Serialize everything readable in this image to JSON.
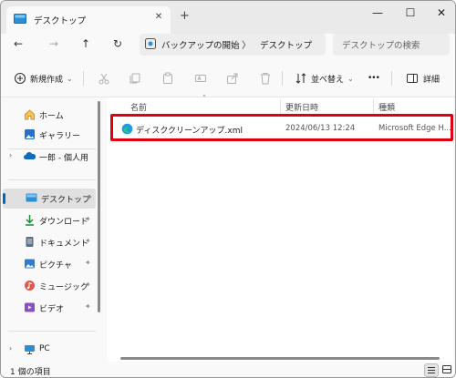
{
  "tab": {
    "title": "デスクトップ",
    "close_glyph": "✕",
    "new_tab_glyph": "+"
  },
  "window_controls": {
    "minimize": "—",
    "maximize": "☐",
    "close": "✕"
  },
  "nav": {
    "back": "←",
    "forward": "→",
    "up": "↑",
    "refresh": "↻"
  },
  "address": {
    "segment1": "バックアップの開始",
    "separator": "〉",
    "segment2": "デスクトップ"
  },
  "search": {
    "placeholder": "デスクトップの検索"
  },
  "toolbar": {
    "new_label": "新規作成",
    "new_chevron": "⌄",
    "sort_label": "並べ替え",
    "sort_chevron": "⌄",
    "more_label": "•••",
    "details_label": "詳細"
  },
  "sidebar": {
    "items": [
      {
        "label": "ホーム",
        "icon": "home-icon"
      },
      {
        "label": "ギャラリー",
        "icon": "gallery-icon"
      },
      {
        "label": "一郎 - 個人用",
        "icon": "onedrive-icon",
        "chevron": "›"
      },
      {
        "label": "デスクトップ",
        "icon": "desktop-icon",
        "pin": "📌"
      },
      {
        "label": "ダウンロード",
        "icon": "download-icon",
        "pin": "📌"
      },
      {
        "label": "ドキュメント",
        "icon": "document-icon",
        "pin": "📌"
      },
      {
        "label": "ピクチャ",
        "icon": "pictures-icon",
        "pin": "📌"
      },
      {
        "label": "ミュージック",
        "icon": "music-icon",
        "pin": "📌"
      },
      {
        "label": "ビデオ",
        "icon": "videos-icon",
        "pin": "📌"
      },
      {
        "label": "PC",
        "icon": "pc-icon",
        "chevron": "›"
      }
    ]
  },
  "table": {
    "columns": [
      "名前",
      "更新日時",
      "種類"
    ],
    "sort_indicator": "⌃",
    "rows": [
      {
        "name": "ディスククリーンアップ.xml",
        "modified": "2024/06/13 12:24",
        "type": "Microsoft Edge H..."
      }
    ]
  },
  "status": {
    "item_count": "1 個の項目"
  },
  "colors": {
    "highlight": "#e0000f",
    "accent": "#0067c0",
    "folder": "#e8b441"
  }
}
